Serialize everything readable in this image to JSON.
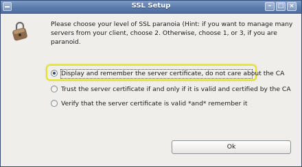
{
  "window": {
    "title": "SSL Setup",
    "window_menu_icon": "window-menu-icon",
    "minimize_icon": "minimize-icon",
    "maximize_icon": "maximize-icon",
    "close_icon": "close-icon"
  },
  "dialog": {
    "icon": "padlock-icon",
    "prompt": "Please choose your level of SSL paranoia (Hint: if you want to manage many servers from your client, choose 2. Otherwise, choose 1, or 3, if you are paranoid.",
    "options": [
      {
        "label": "Display and remember the server certificate, do not care about the CA",
        "selected": true
      },
      {
        "label": "Trust the server certificate if and only if it is valid and certified by the CA",
        "selected": false
      },
      {
        "label": "Verify that the server certificate is valid *and* remember it",
        "selected": false
      }
    ],
    "ok_label": "Ok"
  },
  "colors": {
    "titlebar": "#5a7bab",
    "highlight": "#e4e02c",
    "dialog_bg": "#f0eeeb"
  }
}
